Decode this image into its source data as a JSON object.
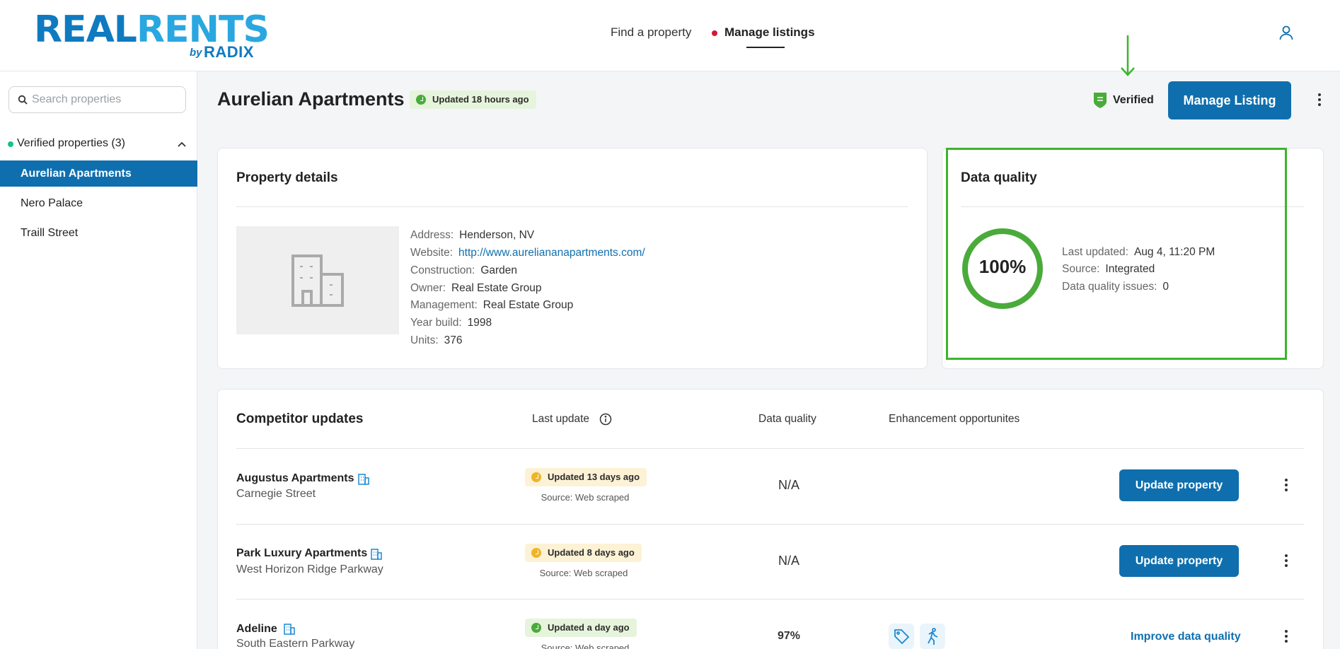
{
  "brand": {
    "real": "REAL",
    "rents": "RENTS",
    "by": "by",
    "radix": "RADIX"
  },
  "nav": {
    "find": "Find a property",
    "manage": "Manage listings"
  },
  "sidebar": {
    "search_placeholder": "Search properties",
    "group_label": "Verified properties (3)",
    "items": [
      {
        "label": "Aurelian Apartments"
      },
      {
        "label": "Nero Palace"
      },
      {
        "label": "Traill Street"
      }
    ]
  },
  "header": {
    "title": "Aurelian Apartments",
    "updated_badge": "Updated 18 hours ago",
    "verified": "Verified",
    "manage_button": "Manage Listing"
  },
  "property_details": {
    "title": "Property details",
    "rows": [
      {
        "label": "Address:",
        "value": "Henderson, NV"
      },
      {
        "label": "Website:",
        "value": "http://www.aureliananapartments.com/"
      },
      {
        "label": "Construction:",
        "value": "Garden"
      },
      {
        "label": "Owner:",
        "value": "Real Estate Group"
      },
      {
        "label": "Management:",
        "value": "Real Estate Group"
      },
      {
        "label": "Year build:",
        "value": "1998"
      },
      {
        "label": "Units:",
        "value": "376"
      }
    ]
  },
  "data_quality": {
    "title": "Data quality",
    "percent_text": "100%",
    "percent": 1.0,
    "rows": [
      {
        "label": "Last updated:",
        "value": "Aug 4, 11:20 PM"
      },
      {
        "label": "Source:",
        "value": "Integrated"
      },
      {
        "label": "Data quality issues:",
        "value": "0"
      }
    ]
  },
  "competitors": {
    "title": "Competitor updates",
    "columns": {
      "last_update": "Last update",
      "data_quality": "Data quality",
      "enhancement": "Enhancement opportunites"
    },
    "rows": [
      {
        "name": "Augustus Apartments",
        "street": "Carnegie Street",
        "badge": "Updated 13 days ago",
        "badge_color": "yellow",
        "source": "Source: Web scraped",
        "dq": "N/A",
        "action": "Update property"
      },
      {
        "name": "Park Luxury Apartments",
        "street": "West Horizon Ridge Parkway",
        "badge": "Updated 8 days ago",
        "badge_color": "yellow",
        "source": "Source: Web scraped",
        "dq": "N/A",
        "action": "Update property"
      },
      {
        "name": "Adeline",
        "street": "South Eastern Parkway",
        "badge": "Updated a day ago",
        "badge_color": "green",
        "source": "Source: Web scraped",
        "dq": "97%",
        "action": "Improve data quality"
      }
    ]
  },
  "colors": {
    "primary": "#0f6fae",
    "accent_green": "#3cb52c",
    "ring": "#4aab3b"
  }
}
